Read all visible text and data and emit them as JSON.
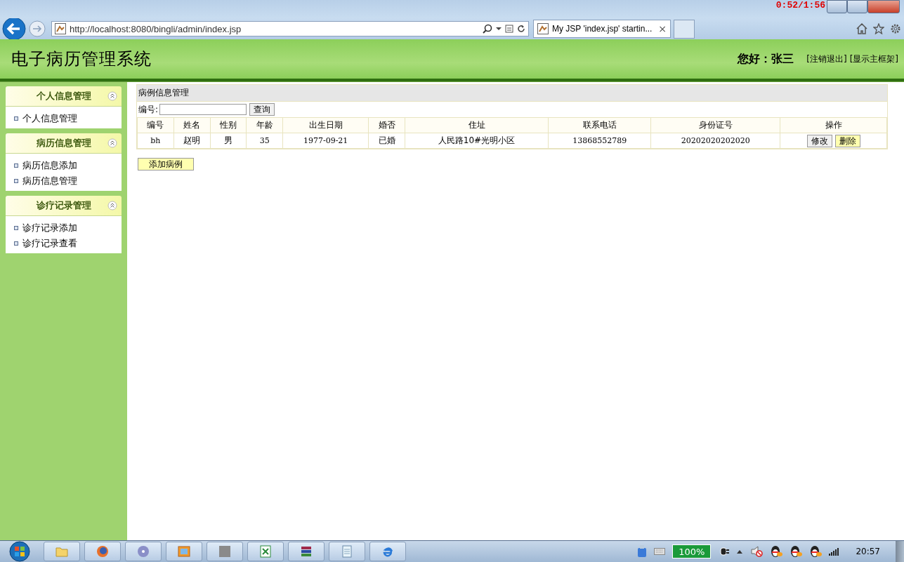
{
  "browser": {
    "overlay_text": "0:52/1:56",
    "url": "http://localhost:8080/bingli/admin/index.jsp",
    "tabs": [
      {
        "title": "My JSP 'index.jsp' startin...",
        "selected": true
      }
    ],
    "close_mark": "×"
  },
  "header": {
    "title": "电子病历管理系统",
    "greeting": "您好：张三",
    "links": [
      "[注销退出]",
      "[显示主框架]"
    ]
  },
  "sidebar": {
    "sections": [
      {
        "title": "个人信息管理",
        "expanded": true,
        "items": [
          "个人信息管理"
        ]
      },
      {
        "title": "病历信息管理",
        "expanded": true,
        "items": [
          "病历信息添加",
          "病历信息管理"
        ]
      },
      {
        "title": "诊疗记录管理",
        "expanded": true,
        "items": [
          "诊疗记录添加",
          "诊疗记录查看"
        ]
      }
    ]
  },
  "panel": {
    "title": "病例信息管理",
    "search": {
      "label": "编号:",
      "button": "查询"
    },
    "table": {
      "columns": [
        "编号",
        "姓名",
        "性别",
        "年龄",
        "出生日期",
        "婚否",
        "住址",
        "联系电话",
        "身份证号",
        "操作"
      ],
      "rows": [
        {
          "cells": [
            "bh",
            "赵明",
            "男",
            "35",
            "1977-09-21",
            "已婚",
            "人民路10#光明小区",
            "13868552789",
            "20202020202020"
          ],
          "actions": [
            {
              "label": "修改",
              "kind": "plain"
            },
            {
              "label": "删除",
              "kind": "highlight"
            }
          ]
        }
      ]
    },
    "add_button": "添加病例"
  },
  "taskbar": {
    "battery": "100%",
    "clock": "20:57"
  }
}
